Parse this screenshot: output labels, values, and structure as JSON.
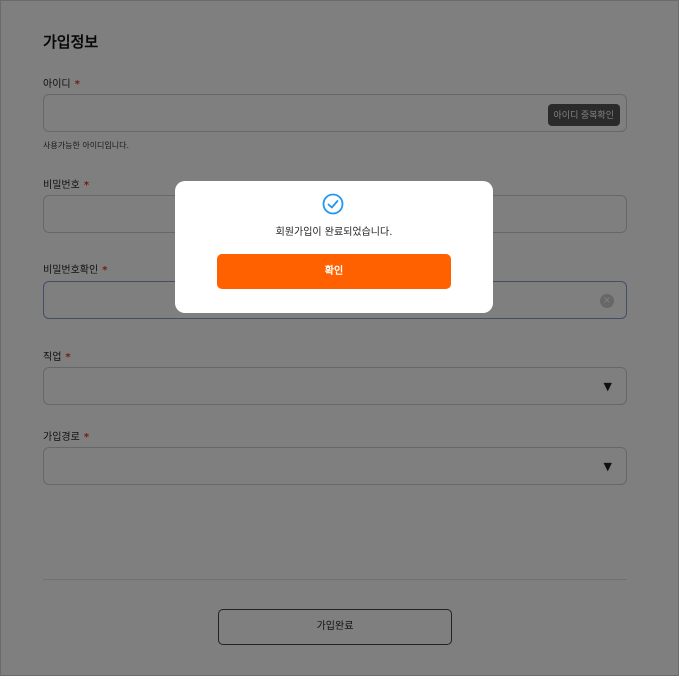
{
  "form": {
    "section_title": "가입정보",
    "required_mark": "*",
    "userid": {
      "label": "아이디",
      "value": "",
      "check_button": "아이디 중복확인",
      "hint": "사용가능한 아이디입니다."
    },
    "password": {
      "label": "비밀번호",
      "value": ""
    },
    "password_confirm": {
      "label": "비밀번호확인",
      "value": ""
    },
    "job": {
      "label": "직업",
      "selected": ""
    },
    "route": {
      "label": "가입경로",
      "selected": ""
    },
    "submit_label": "가입완료"
  },
  "modal": {
    "message": "회원가입이 완료되었습니다.",
    "confirm_label": "확인",
    "accent_color": "#ff6000",
    "icon_color": "#2196f3"
  },
  "icons": [
    "check-circle-icon",
    "clear-icon",
    "dropdown-arrow-icon"
  ]
}
